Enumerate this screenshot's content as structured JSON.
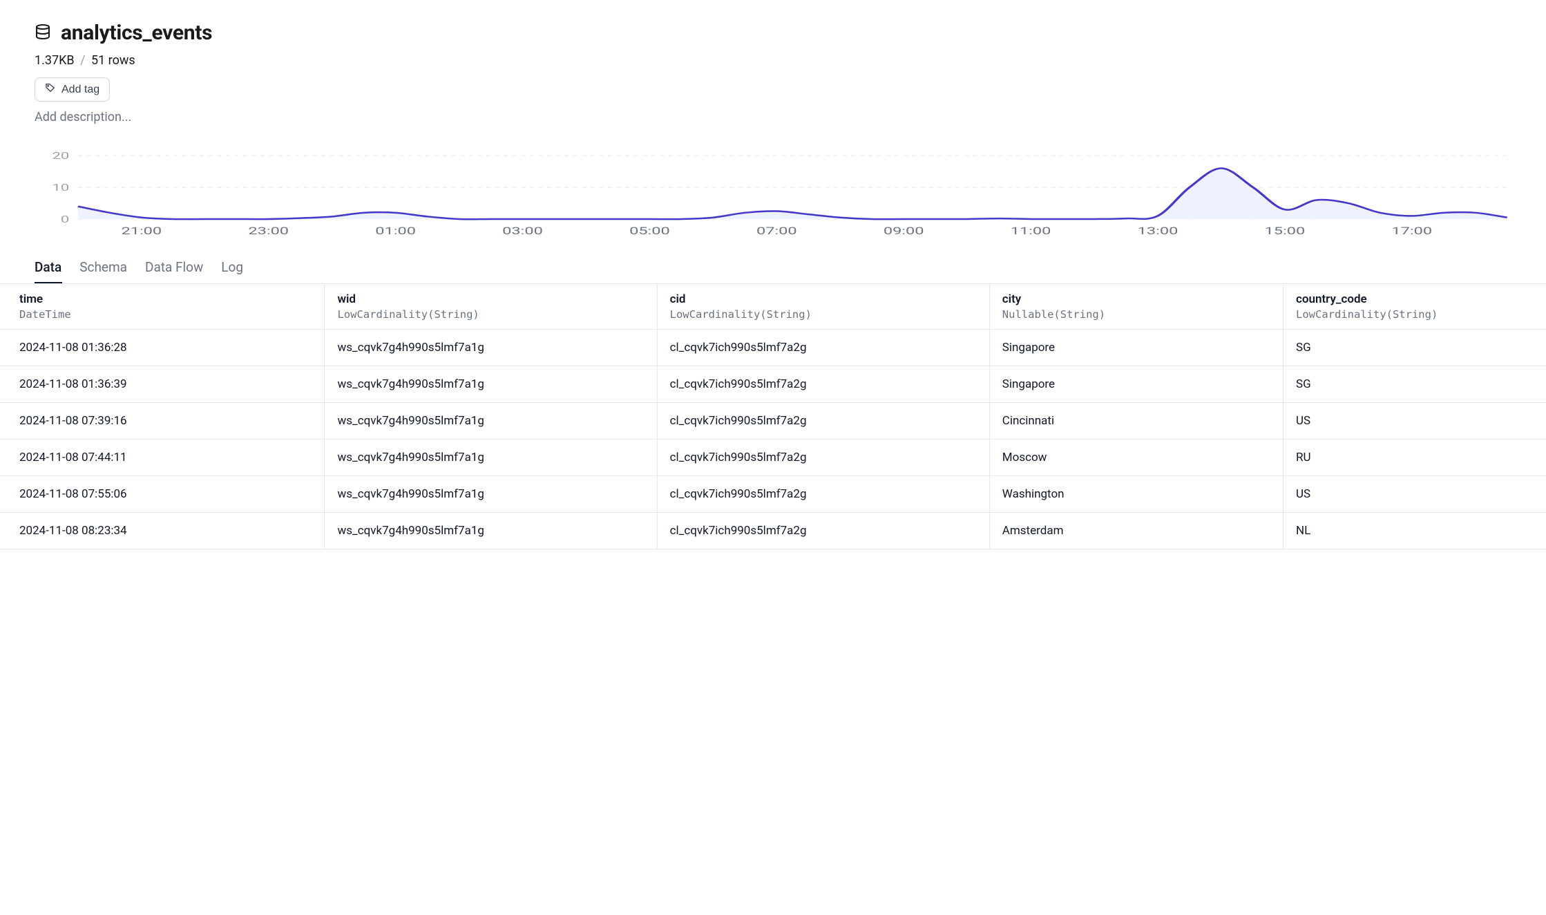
{
  "header": {
    "title": "analytics_events",
    "size_label": "1.37KB",
    "rows_label": "51 rows",
    "add_tag_label": "Add tag",
    "description_placeholder": "Add description..."
  },
  "tabs": [
    {
      "label": "Data",
      "active": true
    },
    {
      "label": "Schema",
      "active": false
    },
    {
      "label": "Data Flow",
      "active": false
    },
    {
      "label": "Log",
      "active": false
    }
  ],
  "columns": [
    {
      "name": "time",
      "type": "DateTime"
    },
    {
      "name": "wid",
      "type": "LowCardinality(String)"
    },
    {
      "name": "cid",
      "type": "LowCardinality(String)"
    },
    {
      "name": "city",
      "type": "Nullable(String)"
    },
    {
      "name": "country_code",
      "type": "LowCardinality(String)"
    }
  ],
  "rows": [
    {
      "time": "2024-11-08 01:36:28",
      "wid": "ws_cqvk7g4h990s5lmf7a1g",
      "cid": "cl_cqvk7ich990s5lmf7a2g",
      "city": "Singapore",
      "country_code": "SG"
    },
    {
      "time": "2024-11-08 01:36:39",
      "wid": "ws_cqvk7g4h990s5lmf7a1g",
      "cid": "cl_cqvk7ich990s5lmf7a2g",
      "city": "Singapore",
      "country_code": "SG"
    },
    {
      "time": "2024-11-08 07:39:16",
      "wid": "ws_cqvk7g4h990s5lmf7a1g",
      "cid": "cl_cqvk7ich990s5lmf7a2g",
      "city": "Cincinnati",
      "country_code": "US"
    },
    {
      "time": "2024-11-08 07:44:11",
      "wid": "ws_cqvk7g4h990s5lmf7a1g",
      "cid": "cl_cqvk7ich990s5lmf7a2g",
      "city": "Moscow",
      "country_code": "RU"
    },
    {
      "time": "2024-11-08 07:55:06",
      "wid": "ws_cqvk7g4h990s5lmf7a1g",
      "cid": "cl_cqvk7ich990s5lmf7a2g",
      "city": "Washington",
      "country_code": "US"
    },
    {
      "time": "2024-11-08 08:23:34",
      "wid": "ws_cqvk7g4h990s5lmf7a1g",
      "cid": "cl_cqvk7ich990s5lmf7a2g",
      "city": "Amsterdam",
      "country_code": "NL"
    }
  ],
  "chart_data": {
    "type": "area",
    "title": "",
    "xlabel": "",
    "ylabel": "",
    "ylim": [
      0,
      22
    ],
    "y_ticks": [
      0,
      10,
      20
    ],
    "x_ticks": [
      "21:00",
      "23:00",
      "01:00",
      "03:00",
      "05:00",
      "07:00",
      "09:00",
      "11:00",
      "13:00",
      "15:00",
      "17:00"
    ],
    "x": [
      "20:00",
      "20:30",
      "21:00",
      "21:30",
      "22:00",
      "22:30",
      "23:00",
      "23:30",
      "00:00",
      "00:30",
      "01:00",
      "01:30",
      "02:00",
      "02:30",
      "03:00",
      "03:30",
      "04:00",
      "04:30",
      "05:00",
      "05:30",
      "06:00",
      "06:30",
      "07:00",
      "07:30",
      "08:00",
      "08:30",
      "09:00",
      "09:30",
      "10:00",
      "10:30",
      "11:00",
      "11:30",
      "12:00",
      "12:30",
      "13:00",
      "13:30",
      "14:00",
      "14:30",
      "15:00",
      "15:30",
      "16:00",
      "16:30",
      "17:00",
      "17:30",
      "18:00",
      "18:30"
    ],
    "values": [
      4,
      2,
      0.5,
      0,
      0,
      0,
      0,
      0.3,
      0.8,
      2,
      2,
      0.8,
      0,
      0,
      0,
      0,
      0,
      0,
      0,
      0,
      0.5,
      2,
      2.5,
      1.5,
      0.5,
      0,
      0,
      0,
      0,
      0.2,
      0,
      0,
      0,
      0.2,
      1,
      10,
      16,
      10,
      3,
      6,
      5,
      2,
      1,
      2,
      2,
      0.5
    ]
  }
}
